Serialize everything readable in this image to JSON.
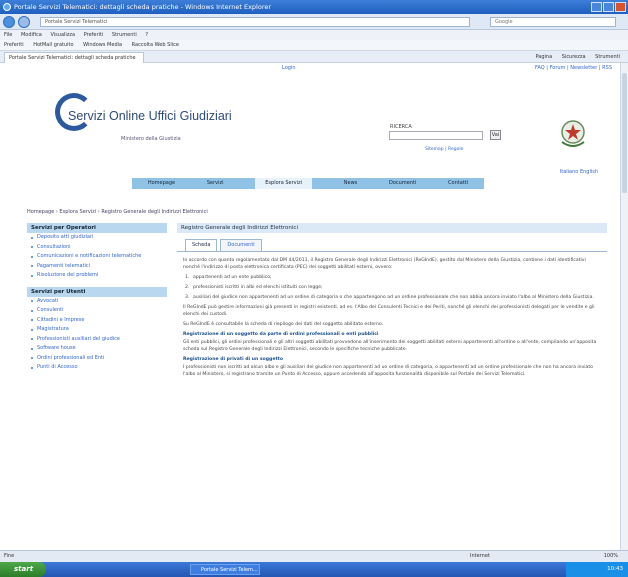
{
  "window": {
    "title": "Portale Servizi Telematici: dettagli scheda pratiche - Windows Internet Explorer"
  },
  "browser": {
    "address": "Portale Servizi Telematici",
    "search_placeholder": "Google",
    "menu": [
      "File",
      "Modifica",
      "Visualizza",
      "Preferiti",
      "Strumenti",
      "?"
    ],
    "favorites_label": "Preferiti",
    "favorites": [
      "HotMail gratuito",
      "Windows Media",
      "Raccolta Web Slice"
    ],
    "tab_title": "Portale Servizi Telematici: dettagli scheda pratiche",
    "commands": [
      "Pagina",
      "Sicurezza",
      "Strumenti"
    ]
  },
  "page": {
    "login_link": "Login",
    "top_right_links": "FAQ | Forum | Newsletter | RSS",
    "site_title": "Servizi Online Uffici Giudiziari",
    "site_subtitle": "Ministero della Giustizia",
    "search_label": "RICERCA",
    "search_button": "Vai",
    "search_links": "Sitemap | Regole",
    "lang_links": "Italiano  English",
    "nav": [
      "Homepage",
      "Servizi",
      "Esplora Servizi",
      "News",
      "Documenti",
      "Contatti"
    ],
    "breadcrumb": "Homepage › Esplora Servizi › Registro Generale degli Indirizzi Elettronici",
    "sidebar": {
      "section1_title": "Servizi per Operatori",
      "section1_items": [
        "Deposito atti giudiziari",
        "Consultazioni",
        "Comunicazioni e notificazioni telematiche",
        "Pagamenti telematici",
        "Risoluzione dei problemi"
      ],
      "section2_title": "Servizi per Utenti",
      "section2_items": [
        "Avvocati",
        "Consulenti",
        "Cittadini e Imprese",
        "Magistratura",
        "Professionisti ausiliari del giudice",
        "Software house",
        "Ordini professionali ed Enti",
        "Punti di Accesso"
      ]
    },
    "content": {
      "title": "Registro Generale degli Indirizzi Elettronici",
      "tabs": [
        "Scheda",
        "Documenti"
      ],
      "paragraphs": [
        "In accordo con quanto regolamentato dal DM 44/2011, il Registro Generale degli Indirizzi Elettronici (ReGIndE), gestito dal Ministero della Giustizia, contiene i dati identificativi nonché l'indirizzo di posta elettronica certificata (PEC) dei soggetti abilitati esterni, ovvero:",
        "Il ReGIndE può gestire informazioni già presenti in registri esistenti, ad es. l'Albo dei Consulenti Tecnici e dei Periti, nonché gli elenchi dei professionisti delegati per le vendite e gli elenchi dei custodi.",
        "Su ReGIndE è consultabile la scheda di riepilogo dei dati del soggetto abilitato esterno."
      ],
      "list": [
        "appartenenti ad un ente pubblico;",
        "professionisti iscritti in albi ed elenchi istituiti con legge;",
        "ausiliari del giudice non appartenenti ad un ordine di categoria o che appartengono ad un ordine professionale che non abbia ancora inviato l'albo al Ministero della Giustizia."
      ],
      "sections": [
        {
          "heading": "Registrazione di un soggetto da parte di ordini professionali o enti pubblici",
          "text": "Gli enti pubblici, gli ordini professionali e gli altri soggetti abilitati provvedono all'inserimento dei soggetti abilitati esterni appartenenti all'ordine o all'ente, compilando un'apposita scheda sul Registro Generale degli Indirizzi Elettronici, secondo le specifiche tecniche pubblicate."
        },
        {
          "heading": "Registrazione di privati di un soggetto",
          "text": "I professionisti non iscritti ad alcun albo e gli ausiliari del giudice non appartenenti ad un ordine di categoria, o appartenenti ad un ordine professionale che non ha ancora inviato l'albo al Ministero, si registrano tramite un Punto di Accesso, oppure accedendo all'apposita funzionalità disponibile sul Portale dei Servizi Telematici."
        }
      ]
    }
  },
  "status": {
    "left": "Fine",
    "zone": "Internet",
    "zoom": "100%"
  },
  "taskbar": {
    "start": "start",
    "tasks": [
      "Portale Servizi Telem..."
    ],
    "clock": "10:43"
  }
}
